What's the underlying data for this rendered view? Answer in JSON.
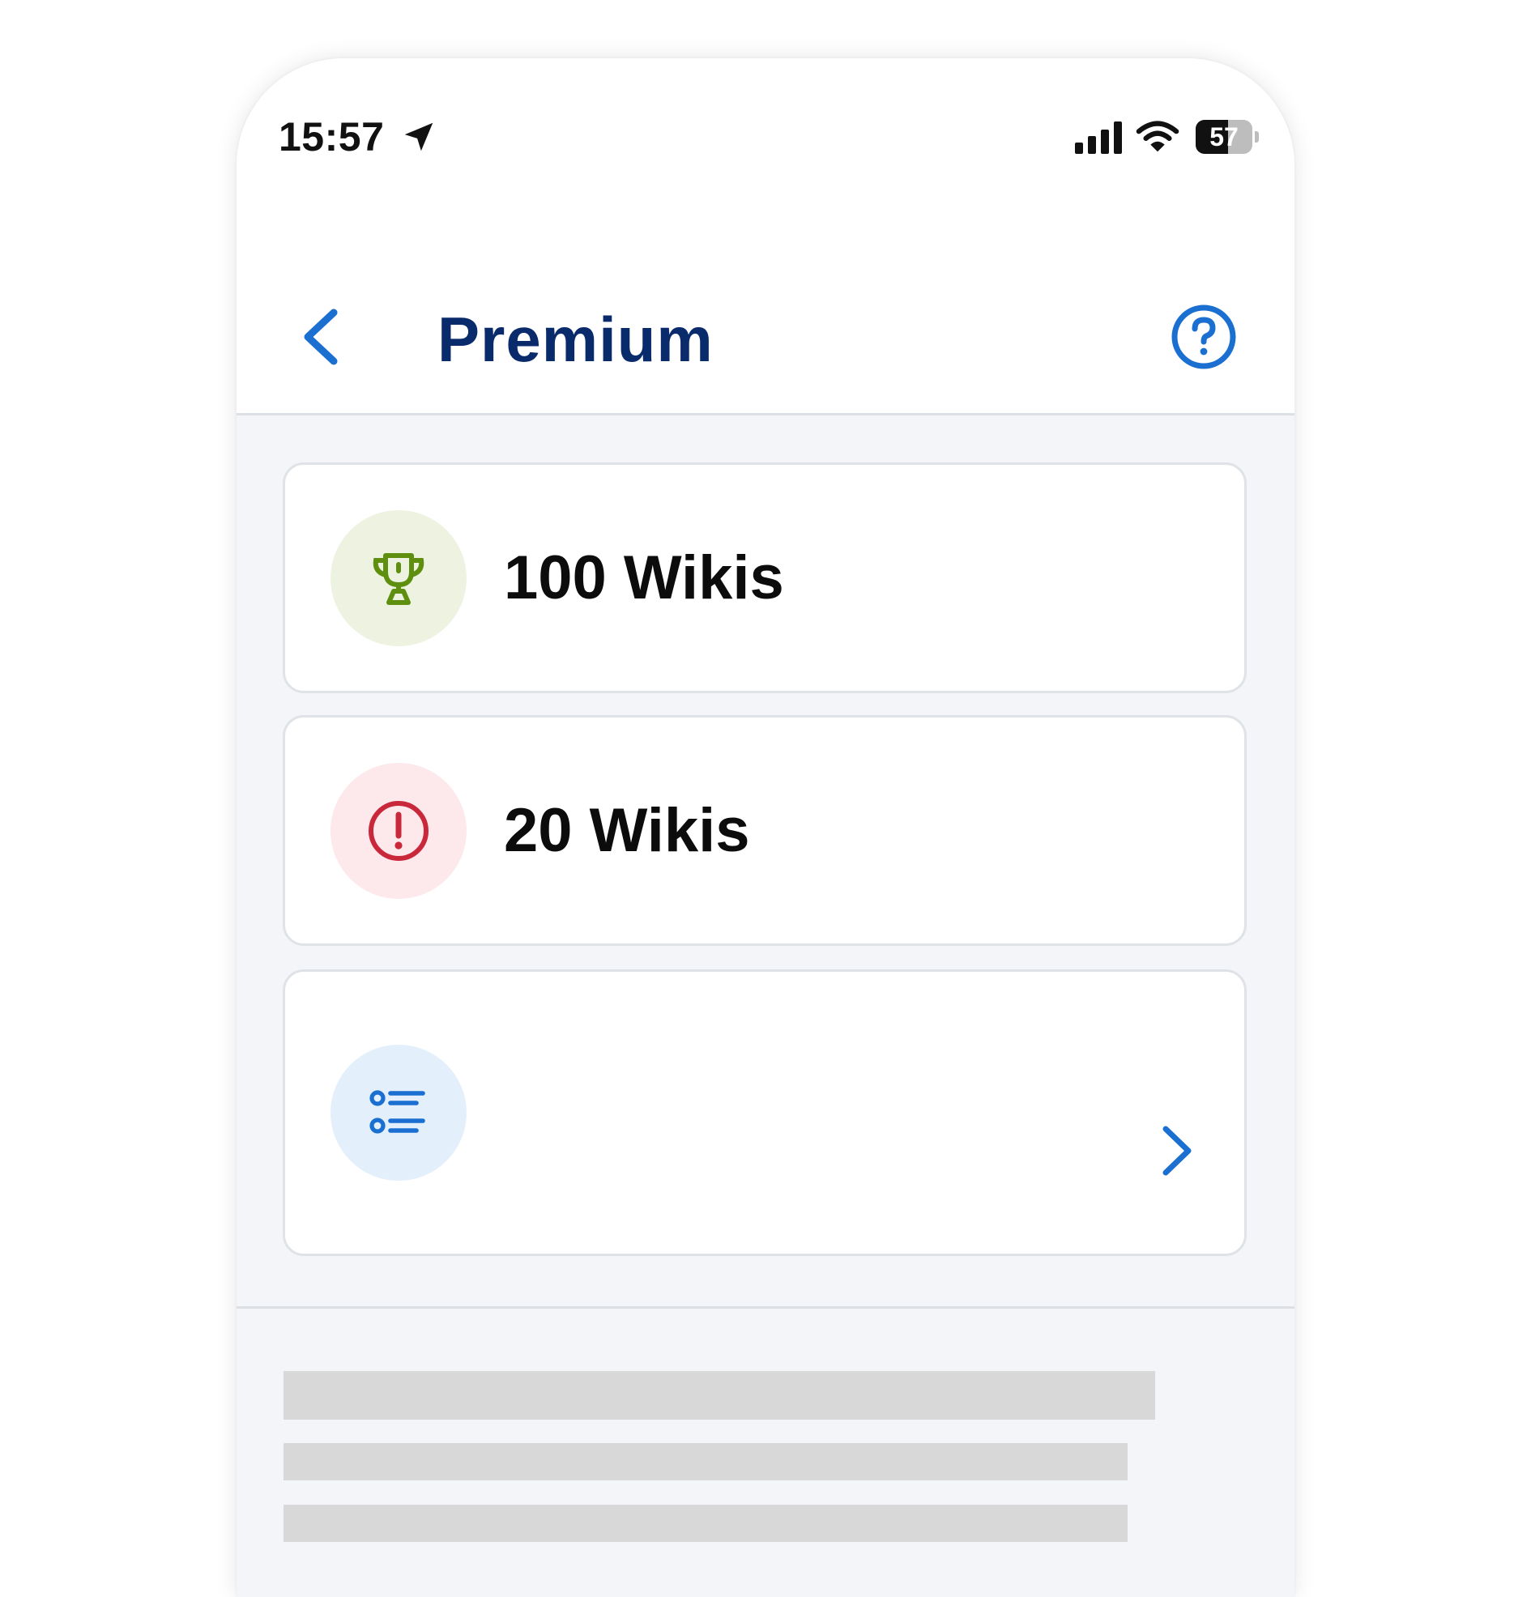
{
  "status_bar": {
    "time": "15:57",
    "battery_level": "57"
  },
  "header": {
    "title": "Premium",
    "back_icon": "chevron-left-icon",
    "help_icon": "help-circle-icon"
  },
  "cards": [
    {
      "title": "100 Wikis",
      "icon": "trophy-icon",
      "icon_color": "#5f8f0e",
      "badge_color": "#eef2e0"
    },
    {
      "title": "20 Wikis",
      "icon": "alert-circle-icon",
      "icon_color": "#c8283a",
      "badge_color": "#fde8ec"
    },
    {
      "title": "",
      "icon": "list-icon",
      "icon_color": "#1a6fd1",
      "badge_color": "#e3f0fc",
      "trailing_icon": "chevron-right-icon"
    }
  ],
  "colors": {
    "accent": "#1a6fd1",
    "title": "#0a2b6b",
    "background": "#f3f5f8",
    "skeleton": "#d8d8d8"
  }
}
